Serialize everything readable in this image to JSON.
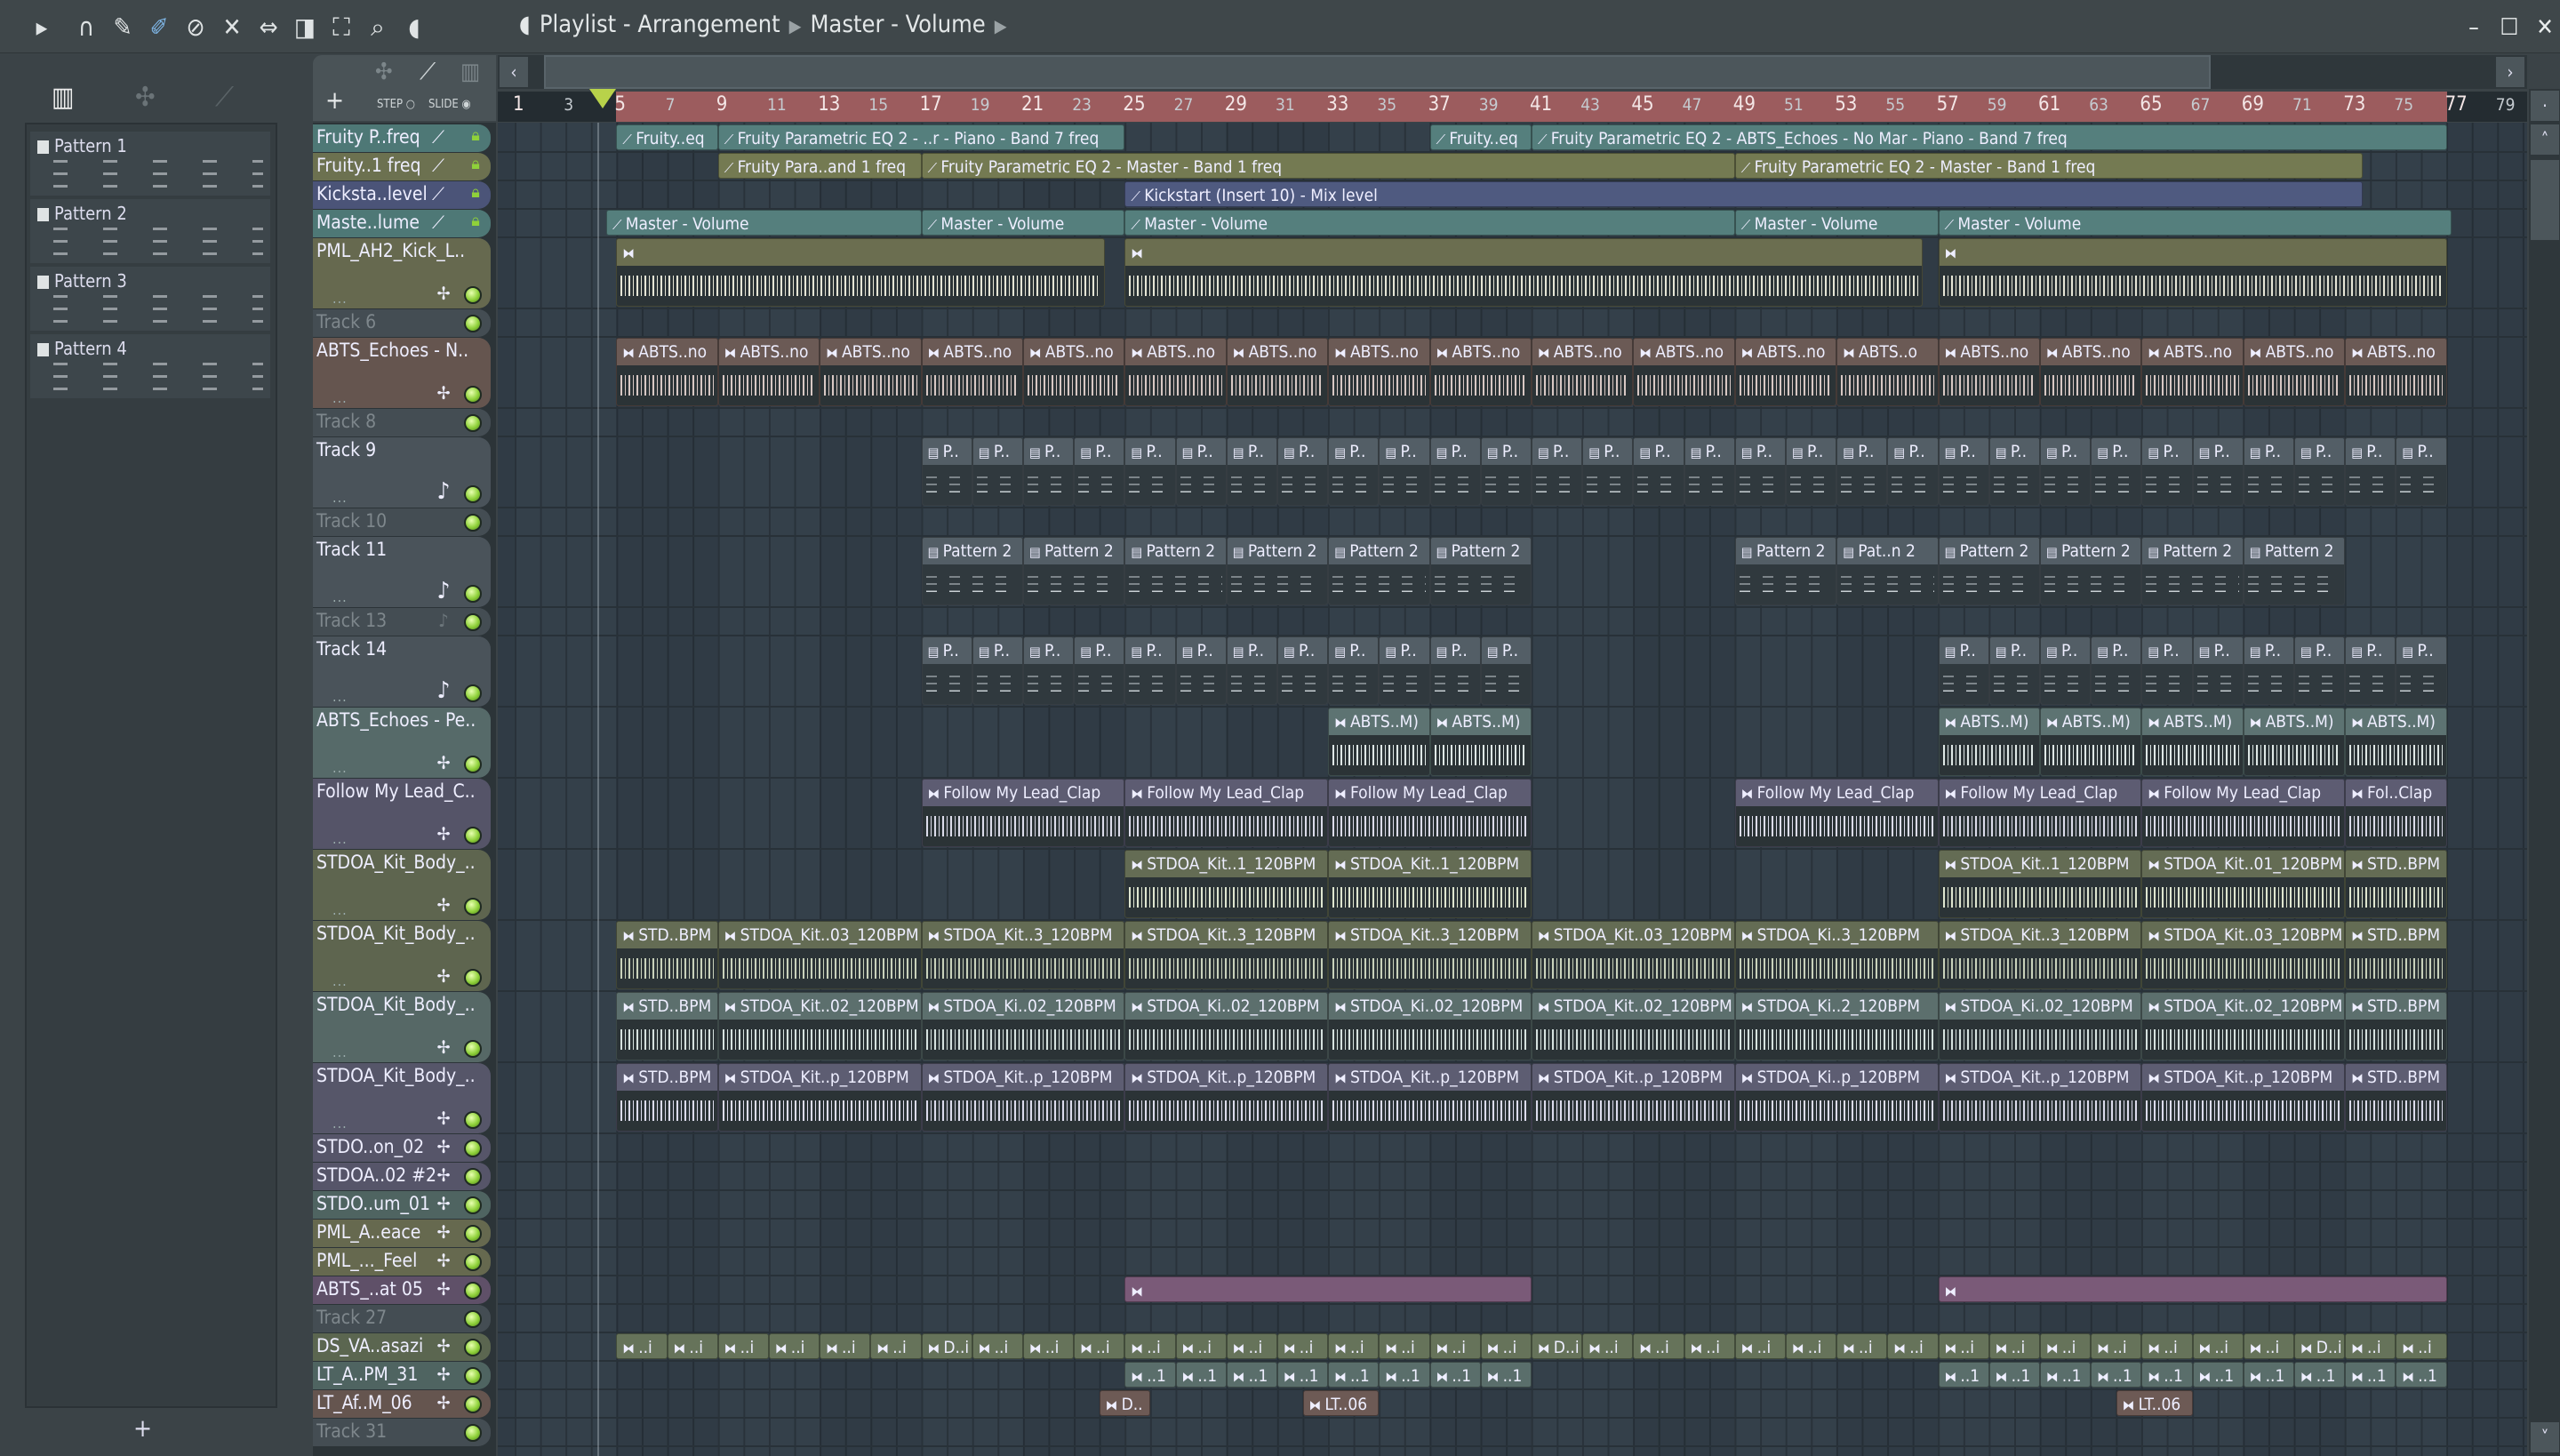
{
  "window": {
    "title": "Playlist - Arrangement",
    "breadcrumb": [
      "Playlist - Arrangement",
      "Master - Volume"
    ],
    "minimize": "–",
    "maximize": "☐",
    "close": "✕"
  },
  "toolbar": {
    "icons": [
      "play-arrow-icon",
      "magnet-snap-icon",
      "pencil-icon",
      "paint-brush-icon",
      "delete-icon",
      "mute-icon",
      "slip-icon",
      "slice-icon",
      "select-icon",
      "zoom-icon",
      "playback-icon",
      "speaker-icon"
    ]
  },
  "picker": {
    "tabs": [
      "piano-icon",
      "audio-icon",
      "automation-icon"
    ],
    "step": "STEP",
    "slide": "SLIDE",
    "add": "+"
  },
  "patterns": [
    "Pattern 1",
    "Pattern 2",
    "Pattern 3",
    "Pattern 4"
  ],
  "ruler": {
    "numbers": [
      1,
      3,
      5,
      7,
      9,
      11,
      13,
      15,
      17,
      19,
      21,
      23,
      25,
      27,
      29,
      31,
      33,
      35,
      37,
      39,
      41,
      43,
      45,
      47,
      49,
      51,
      53,
      55,
      57,
      59,
      61,
      63,
      65,
      67,
      69,
      71,
      73,
      75,
      77,
      79
    ],
    "loop_start": 5,
    "loop_end": 77
  },
  "tracks": [
    {
      "name": "Fruity P..freq",
      "kind": "automation",
      "color": "#4e7876",
      "clip": "#557f7d",
      "clips": [
        {
          "start": 5,
          "end": 9,
          "label": "Fruity..eq"
        },
        {
          "start": 9,
          "end": 25,
          "label": "Fruity Parametric EQ 2 - ..r - Piano - Band 7 freq"
        },
        {
          "start": 37,
          "end": 41,
          "label": "Fruity..eq"
        },
        {
          "start": 41,
          "end": 77,
          "label": "Fruity Parametric EQ 2 - ABTS_Echoes - No Mar - Piano - Band 7 freq"
        }
      ]
    },
    {
      "name": "Fruity..1 freq",
      "kind": "automation",
      "color": "#6c7150",
      "clip": "#747a52",
      "clips": [
        {
          "start": 9,
          "end": 17,
          "label": "Fruity Para..and 1 freq"
        },
        {
          "start": 17,
          "end": 49,
          "label": "Fruity Parametric EQ 2 - Master - Band 1 freq"
        },
        {
          "start": 49,
          "end": 73.7,
          "label": "Fruity Parametric EQ 2 - Master - Band 1 freq"
        }
      ]
    },
    {
      "name": "Kicksta..level",
      "kind": "automation",
      "color": "#4b5478",
      "clip": "#4f5a80",
      "clips": [
        {
          "start": 25,
          "end": 73.7,
          "label": "Kickstart (Insert 10) - Mix level"
        }
      ]
    },
    {
      "name": "Maste..lume",
      "kind": "automation",
      "color": "#4e7876",
      "clip": "#557f7d",
      "clips": [
        {
          "start": 4.6,
          "end": 17,
          "label": "Master - Volume"
        },
        {
          "start": 17,
          "end": 25,
          "label": "Master - Volume"
        },
        {
          "start": 25,
          "end": 49,
          "label": "Master - Volume"
        },
        {
          "start": 49,
          "end": 57,
          "label": "Master - Volume"
        },
        {
          "start": 57,
          "end": 77.2,
          "label": "Master - Volume"
        }
      ]
    },
    {
      "name": "PML_AH2_Kick_L..",
      "kind": "audio",
      "expanded": true,
      "color": "#66694f",
      "clip": "#6b6e50",
      "wave": "#e6e6d6",
      "clips": [
        {
          "start": 5,
          "end": 24.2,
          "label": ""
        },
        {
          "start": 25,
          "end": 56.4,
          "label": ""
        },
        {
          "start": 57,
          "end": 77,
          "label": ""
        }
      ]
    },
    {
      "name": "Track 6",
      "kind": "empty",
      "color": "#444d53",
      "clips": []
    },
    {
      "name": "ABTS_Echoes - N..",
      "kind": "audio",
      "expanded": true,
      "color": "#65554f",
      "clip": "#6b5a55",
      "wave": "#d8c8c4",
      "groups": [
        {
          "start": 5,
          "len": 4,
          "labels": [
            "ABTS..no",
            "ABTS..no",
            "ABTS..no",
            "ABTS..no",
            "ABTS..no",
            "ABTS..no",
            "ABTS..no",
            "ABTS..no",
            "ABTS..no",
            "ABTS..no",
            "ABTS..no",
            "ABTS..no",
            "ABTS..o"
          ]
        },
        {
          "start": 57,
          "len": 4,
          "labels": [
            "ABTS..no",
            "ABTS..no",
            "ABTS..no",
            "ABTS..no",
            "ABTS..no"
          ]
        }
      ]
    },
    {
      "name": "Track 8",
      "kind": "empty",
      "color": "#444d53",
      "clips": []
    },
    {
      "name": "Track 9",
      "kind": "pattern",
      "expanded": true,
      "color": "#4a535a",
      "clip": "#535e66",
      "wave": "#c9d0d4",
      "groups": [
        {
          "start": 17,
          "len": 2,
          "labels": [
            "P..",
            "P..",
            "P..",
            "P..",
            "P..",
            "P..",
            "P..",
            "P..",
            "P..",
            "P..",
            "P..",
            "P..",
            "P..",
            "P..",
            "P..",
            "P..",
            "P..",
            "P..",
            "P..",
            "P.."
          ]
        },
        {
          "start": 57,
          "len": 2,
          "labels": [
            "P..",
            "P..",
            "P..",
            "P..",
            "P..",
            "P..",
            "P..",
            "P..",
            "P..",
            "P.."
          ]
        }
      ]
    },
    {
      "name": "Track 10",
      "kind": "empty",
      "color": "#444d53",
      "clips": []
    },
    {
      "name": "Track 11",
      "kind": "pattern",
      "expanded": true,
      "color": "#4a535a",
      "clip": "#535e66",
      "wave": "#c9d0d4",
      "groups": [
        {
          "start": 17,
          "len": 4,
          "labels": [
            "Pattern 2",
            "Pattern 2",
            "Pattern 2",
            "Pattern 2",
            "Pattern 2",
            "Pattern 2"
          ]
        },
        {
          "start": 49,
          "len": 4,
          "labels": [
            "Pattern 2",
            "Pat..n 2"
          ]
        },
        {
          "start": 57,
          "len": 4,
          "labels": [
            "Pattern 2",
            "Pattern 2",
            "Pattern 2",
            "Pattern 2"
          ]
        }
      ]
    },
    {
      "name": "Track 13",
      "kind": "empty-note",
      "color": "#444d53",
      "clips": []
    },
    {
      "name": "Track 14",
      "kind": "pattern",
      "expanded": true,
      "color": "#4a535a",
      "clip": "#535e66",
      "wave": "#c9d0d4",
      "groups": [
        {
          "start": 17,
          "len": 2,
          "labels": [
            "P..",
            "P..",
            "P..",
            "P..",
            "P..",
            "P..",
            "P..",
            "P..",
            "P..",
            "P..",
            "P..",
            "P.."
          ]
        },
        {
          "start": 57,
          "len": 2,
          "labels": [
            "P..",
            "P..",
            "P..",
            "P..",
            "P..",
            "P..",
            "P..",
            "P..",
            "P..",
            "P.."
          ]
        }
      ]
    },
    {
      "name": "ABTS_Echoes - Pe..",
      "kind": "audio",
      "expanded": true,
      "color": "#566a69",
      "clip": "#5d7372",
      "wave": "#dfe8e6",
      "groups": [
        {
          "start": 33,
          "len": 4,
          "labels": [
            "ABTS..M)",
            "ABTS..M)"
          ]
        },
        {
          "start": 57,
          "len": 4,
          "labels": [
            "ABTS..M)",
            "ABTS..M)",
            "ABTS..M)",
            "ABTS..M)",
            "ABTS..M)"
          ]
        }
      ]
    },
    {
      "name": "Follow My Lead_C..",
      "kind": "audio",
      "expanded": true,
      "color": "#555468",
      "clip": "#5d5c72",
      "wave": "#dcdcea",
      "clips": [
        {
          "start": 17,
          "end": 25,
          "label": "Follow My Lead_Clap"
        },
        {
          "start": 25,
          "end": 33,
          "label": "Follow My Lead_Clap"
        },
        {
          "start": 33,
          "end": 41,
          "label": "Follow My Lead_Clap"
        },
        {
          "start": 49,
          "end": 57,
          "label": "Follow My Lead_Clap"
        },
        {
          "start": 57,
          "end": 65,
          "label": "Follow My Lead_Clap"
        },
        {
          "start": 65,
          "end": 73,
          "label": "Follow My Lead_Clap"
        },
        {
          "start": 73,
          "end": 77,
          "label": "Fol..Clap"
        }
      ]
    },
    {
      "name": "STDOA_Kit_Body_..",
      "kind": "audio",
      "expanded": true,
      "color": "#5e654f",
      "clip": "#646c54",
      "wave": "#dfe6d0",
      "clips": [
        {
          "start": 25,
          "end": 33,
          "label": "STDOA_Kit..1_120BPM"
        },
        {
          "start": 33,
          "end": 41,
          "label": "STDOA_Kit..1_120BPM"
        },
        {
          "start": 57,
          "end": 65,
          "label": "STDOA_Kit..1_120BPM"
        },
        {
          "start": 65,
          "end": 73,
          "label": "STDOA_Kit..01_120BPM"
        },
        {
          "start": 73,
          "end": 77,
          "label": "STD..BPM"
        }
      ]
    },
    {
      "name": "STDOA_Kit_Body_..",
      "kind": "audio",
      "expanded": true,
      "color": "#5e654f",
      "clip": "#646c54",
      "wave": "#c9d2bb",
      "clips": [
        {
          "start": 5,
          "end": 9,
          "label": "STD..BPM"
        },
        {
          "start": 9,
          "end": 17,
          "label": "STDOA_Kit..03_120BPM"
        },
        {
          "start": 17,
          "end": 25,
          "label": "STDOA_Kit..3_120BPM"
        },
        {
          "start": 25,
          "end": 33,
          "label": "STDOA_Kit..3_120BPM"
        },
        {
          "start": 33,
          "end": 41,
          "label": "STDOA_Kit..3_120BPM"
        },
        {
          "start": 41,
          "end": 49,
          "label": "STDOA_Kit..03_120BPM"
        },
        {
          "start": 49,
          "end": 57,
          "label": "STDOA_Ki..3_120BPM"
        },
        {
          "start": 57,
          "end": 65,
          "label": "STDOA_Kit..3_120BPM"
        },
        {
          "start": 65,
          "end": 73,
          "label": "STDOA_Kit..03_120BPM"
        },
        {
          "start": 73,
          "end": 77,
          "label": "STD..BPM"
        }
      ]
    },
    {
      "name": "STDOA_Kit_Body_..",
      "kind": "audio",
      "expanded": true,
      "color": "#566866",
      "clip": "#5c6f6d",
      "wave": "#d6e2df",
      "clips": [
        {
          "start": 5,
          "end": 9,
          "label": "STD..BPM"
        },
        {
          "start": 9,
          "end": 17,
          "label": "STDOA_Kit..02_120BPM"
        },
        {
          "start": 17,
          "end": 25,
          "label": "STDOA_Ki..02_120BPM"
        },
        {
          "start": 25,
          "end": 33,
          "label": "STDOA_Ki..02_120BPM"
        },
        {
          "start": 33,
          "end": 41,
          "label": "STDOA_Ki..02_120BPM"
        },
        {
          "start": 41,
          "end": 49,
          "label": "STDOA_Kit..02_120BPM"
        },
        {
          "start": 49,
          "end": 57,
          "label": "STDOA_Ki..2_120BPM"
        },
        {
          "start": 57,
          "end": 65,
          "label": "STDOA_Ki..02_120BPM"
        },
        {
          "start": 65,
          "end": 73,
          "label": "STDOA_Kit..02_120BPM"
        },
        {
          "start": 73,
          "end": 77,
          "label": "STD..BPM"
        }
      ]
    },
    {
      "name": "STDOA_Kit_Body_..",
      "kind": "audio",
      "expanded": true,
      "color": "#565669",
      "clip": "#5d5d72",
      "wave": "#dcdcec",
      "clips": [
        {
          "start": 5,
          "end": 9,
          "label": "STD..BPM"
        },
        {
          "start": 9,
          "end": 17,
          "label": "STDOA_Kit..p_120BPM"
        },
        {
          "start": 17,
          "end": 25,
          "label": "STDOA_Kit..p_120BPM"
        },
        {
          "start": 25,
          "end": 33,
          "label": "STDOA_Kit..p_120BPM"
        },
        {
          "start": 33,
          "end": 41,
          "label": "STDOA_Kit..p_120BPM"
        },
        {
          "start": 41,
          "end": 49,
          "label": "STDOA_Kit..p_120BPM"
        },
        {
          "start": 49,
          "end": 57,
          "label": "STDOA_Ki..p_120BPM"
        },
        {
          "start": 57,
          "end": 65,
          "label": "STDOA_Kit..p_120BPM"
        },
        {
          "start": 65,
          "end": 73,
          "label": "STDOA_Kit..p_120BPM"
        },
        {
          "start": 73,
          "end": 77,
          "label": "STD..BPM"
        }
      ]
    },
    {
      "name": "STDO..on_02",
      "kind": "audio",
      "color": "#565569",
      "clips": []
    },
    {
      "name": "STDOA..02 #2",
      "kind": "audio",
      "color": "#565569",
      "clips": []
    },
    {
      "name": "STDO..um_01",
      "kind": "audio",
      "color": "#4f6461",
      "clips": []
    },
    {
      "name": "PML_A..eace",
      "kind": "audio",
      "color": "#66694f",
      "clips": []
    },
    {
      "name": "PML_..._Feel",
      "kind": "audio",
      "color": "#66694f",
      "clips": []
    },
    {
      "name": "ABTS_..at 05",
      "kind": "audio",
      "color": "#5f5068",
      "clip": "#7a5a78",
      "clips": [
        {
          "start": 25,
          "end": 41,
          "label": ""
        },
        {
          "start": 57,
          "end": 77,
          "label": ""
        }
      ]
    },
    {
      "name": "Track 27",
      "kind": "empty",
      "color": "#444d53",
      "clips": []
    },
    {
      "name": "DS_VA..asazi",
      "kind": "audio",
      "color": "#5b6650",
      "clip": "#66735a",
      "groups": [
        {
          "start": 5,
          "len": 2,
          "labels": [
            "..i",
            "..i",
            "..i",
            "..i",
            "..i",
            "..i",
            "D..i",
            "..i",
            "..i",
            "..i",
            "..i",
            "..i",
            "..i",
            "..i",
            "..i",
            "..i",
            "..i",
            "..i",
            "D..i",
            "..i",
            "..i",
            "..i",
            "..i",
            "..i",
            "..i",
            "..i"
          ]
        },
        {
          "start": 57,
          "len": 2,
          "labels": [
            "..i",
            "..i",
            "..i",
            "..i",
            "..i",
            "..i",
            "..i",
            "D..i",
            "..i",
            "..i"
          ]
        }
      ]
    },
    {
      "name": "LT_A..PM_31",
      "kind": "audio",
      "color": "#4f6461",
      "clip": "#5a6e6b",
      "groups": [
        {
          "start": 25,
          "len": 2,
          "labels": [
            "..1",
            "..1",
            "..1",
            "..1",
            "..1",
            "..1",
            "..1",
            "..1"
          ]
        },
        {
          "start": 57,
          "len": 2,
          "labels": [
            "..1",
            "..1",
            "..1",
            "..1",
            "..1",
            "..1",
            "..1",
            "..1",
            "..1",
            "..1"
          ]
        }
      ]
    },
    {
      "name": "LT_Af..M_06",
      "kind": "audio",
      "color": "#65554f",
      "clip": "#6d5a55",
      "clips": [
        {
          "start": 24,
          "end": 26,
          "label": "D.."
        },
        {
          "start": 32,
          "end": 35,
          "label": "LT..06"
        },
        {
          "start": 64,
          "end": 67,
          "label": "LT..06"
        }
      ]
    },
    {
      "name": "Track 31",
      "kind": "empty",
      "color": "#444d53",
      "clips": []
    }
  ]
}
